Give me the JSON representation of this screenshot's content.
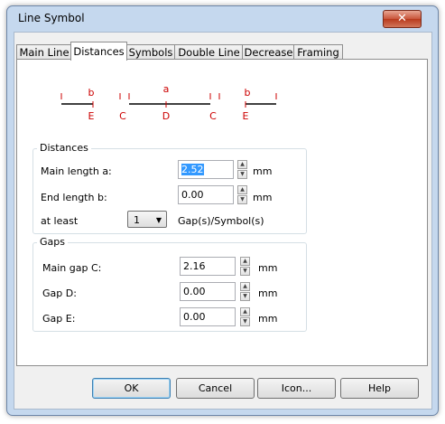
{
  "window": {
    "title": "Line Symbol",
    "close_label": "✕"
  },
  "tabs": [
    {
      "label": "Main Line",
      "active": false
    },
    {
      "label": "Distances",
      "active": true
    },
    {
      "label": "Symbols",
      "active": false
    },
    {
      "label": "Double Line",
      "active": false
    },
    {
      "label": "Decrease",
      "active": false
    },
    {
      "label": "Framing",
      "active": false
    }
  ],
  "diagram": {
    "top_labels": [
      "b",
      "a",
      "b"
    ],
    "bottom_labels": [
      "E",
      "C",
      "D",
      "C",
      "E"
    ],
    "color": "#cc0000"
  },
  "distances": {
    "title": "Distances",
    "main_length_label": "Main length a:",
    "main_length_value": "2.52",
    "end_length_label": "End length b:",
    "end_length_value": "0.00",
    "at_least_label": "at least",
    "at_least_value": "1",
    "gaps_symbols_label": "Gap(s)/Symbol(s)",
    "unit": "mm"
  },
  "gaps": {
    "title": "Gaps",
    "main_gap_label": "Main gap C:",
    "main_gap_value": "2.16",
    "gap_d_label": "Gap D:",
    "gap_d_value": "0.00",
    "gap_e_label": "Gap E:",
    "gap_e_value": "0.00",
    "unit": "mm"
  },
  "buttons": {
    "ok": "OK",
    "cancel": "Cancel",
    "icon": "Icon...",
    "help": "Help"
  }
}
